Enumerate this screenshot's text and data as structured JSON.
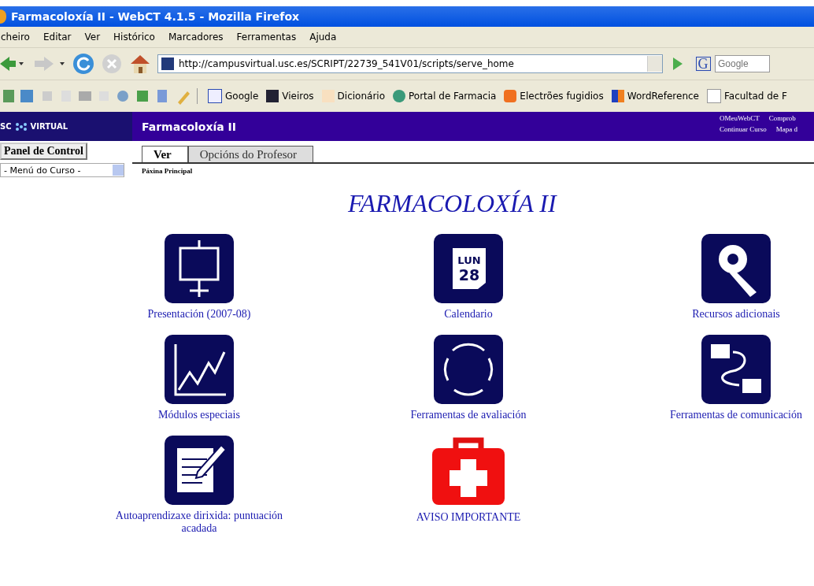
{
  "window": {
    "title": "Farmacoloxía II - WebCT 4.1.5 - Mozilla Firefox"
  },
  "menu": [
    "cheiro",
    "Editar",
    "Ver",
    "Histórico",
    "Marcadores",
    "Ferramentas",
    "Ajuda"
  ],
  "address": {
    "value": "http://campusvirtual.usc.es/SCRIPT/22739_541V01/scripts/serve_home"
  },
  "search": {
    "engine": "G",
    "placeholder": "Google"
  },
  "bookmarks": [
    {
      "label": "Google",
      "kind": "google"
    },
    {
      "label": "Vieiros",
      "kind": "dots"
    },
    {
      "label": "Dicionário",
      "kind": "figure"
    },
    {
      "label": "Portal de Farmacia",
      "kind": "pharmacy"
    },
    {
      "label": "Electrões fugidios",
      "kind": "blogger"
    },
    {
      "label": "WordReference",
      "kind": "wr"
    },
    {
      "label": "Facultad de F",
      "kind": "page"
    }
  ],
  "header": {
    "logo_left": "SC",
    "logo_right": "VIRTUAL",
    "course": "Farmacoloxía II",
    "links": [
      "OMeuWebCT",
      "Comprob",
      "Continuar Curso",
      "Mapa d"
    ]
  },
  "sidebar": {
    "button": "Panel de Control",
    "menu": "- Menú do Curso -"
  },
  "tabs": [
    {
      "label": "Ver",
      "selected": true
    },
    {
      "label": "Opcións do Profesor",
      "selected": false
    }
  ],
  "breadcrumb": "Páxina Principal",
  "heading": "FARMACOLOXÍA II",
  "tools": [
    {
      "label": "Presentación (2007-08)",
      "kind": "easel"
    },
    {
      "label": "Calendario",
      "kind": "calendar",
      "day": "LUN",
      "date": "28"
    },
    {
      "label": "Recursos adicionais",
      "kind": "ribbon"
    },
    {
      "label": "Módulos especiais",
      "kind": "chart"
    },
    {
      "label": "Ferramentas de avaliación",
      "kind": "quiz"
    },
    {
      "label": "Ferramentas de comunicación",
      "kind": "exchange"
    },
    {
      "label": "Autoaprendizaxe dirixida: puntuación acadada",
      "kind": "notepad"
    },
    {
      "label": "AVISO IMPORTANTE",
      "kind": "firstaid"
    }
  ]
}
